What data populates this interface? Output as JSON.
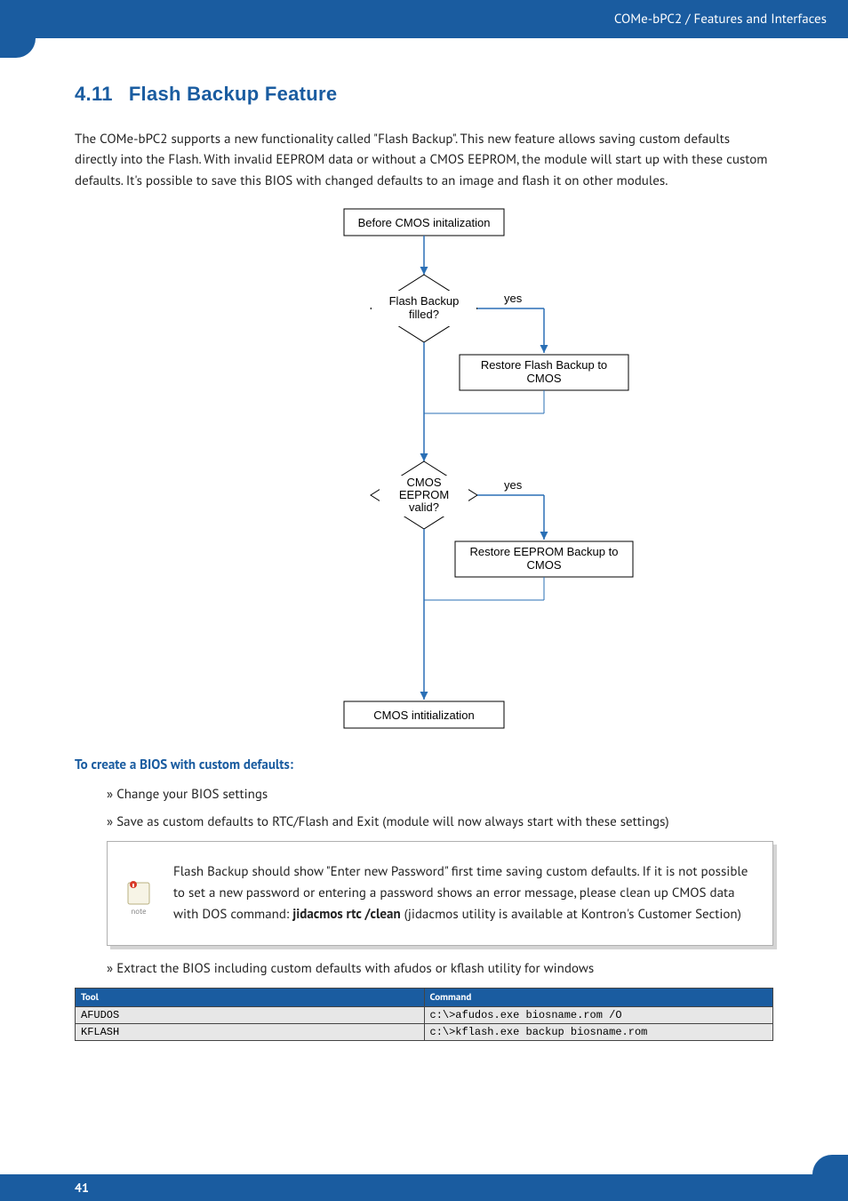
{
  "header": {
    "breadcrumb": "COMe-bPC2 / Features and Interfaces"
  },
  "section": {
    "number": "4.11",
    "title": "Flash Backup Feature",
    "intro": "The COMe-bPC2 supports a new functionality called \"Flash Backup\". This new feature allows saving custom defaults directly into the Flash. With invalid EEPROM data or without a CMOS EEPROM, the module will start up with these custom defaults. It's possible to save this BIOS with changed defaults to an image and flash it on other modules."
  },
  "flowchart": {
    "n1": "Before CMOS initalization",
    "d1": "Flash Backup filled?",
    "yes1": "yes",
    "r1a": "Restore Flash Backup to",
    "r1b": "CMOS",
    "d2a": "CMOS",
    "d2b": "EEPROM",
    "d2c": "valid?",
    "yes2": "yes",
    "r2a": "Restore EEPROM Backup to",
    "r2b": "CMOS",
    "n3": "CMOS intitialization"
  },
  "subheading": "To create a BIOS with custom defaults:",
  "bullets": {
    "b1": "Change your BIOS settings",
    "b2": "Save as custom defaults to RTC/Flash and Exit (module will now always start with these settings)",
    "b3": "Extract the BIOS including custom defaults with afudos or kflash utility for windows"
  },
  "note": {
    "label": "note",
    "text_pre": "Flash Backup should show \"Enter new Password\" first time saving custom defaults. If it is not possible to set a new password or entering a password shows an error message, please clean up CMOS data with DOS command: ",
    "cmd": "jidacmos rtc /clean",
    "text_post": " (jidacmos utility is available at Kontron's Customer Section)"
  },
  "table": {
    "headers": {
      "tool": "Tool",
      "command": "Command"
    },
    "rows": [
      {
        "tool": "AFUDOS",
        "command": "c:\\>afudos.exe biosname.rom /O"
      },
      {
        "tool": "KFLASH",
        "command": "c:\\>kflash.exe backup biosname.rom"
      }
    ]
  },
  "footer": {
    "page": "41"
  }
}
